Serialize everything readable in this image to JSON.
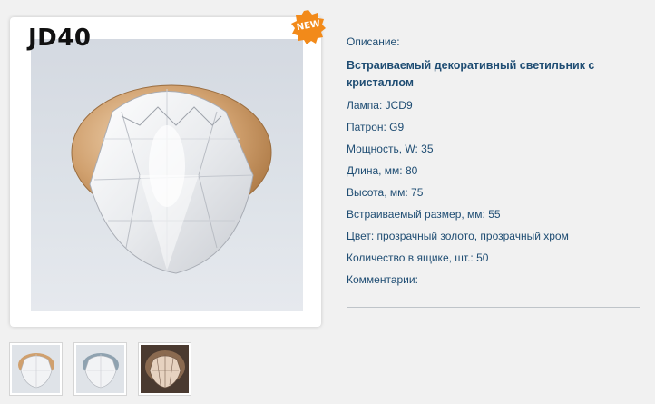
{
  "product": {
    "model": "JD40",
    "badge": "NEW"
  },
  "details": {
    "description_label": "Описание:",
    "title": "Встраиваемый декоративный светильник с кристаллом",
    "specs": [
      "Лампа: JCD9",
      "Патрон: G9",
      "Мощность, W: 35",
      "Длина, мм: 80",
      "Высота, мм: 75",
      "Встраиваемый размер, мм: 55",
      "Цвет: прозрачный золото, прозрачный хром",
      "Количество в ящике, шт.: 50",
      "Комментарии:"
    ]
  },
  "thumbnails": [
    {
      "name": "thumbnail-gold"
    },
    {
      "name": "thumbnail-chrome"
    },
    {
      "name": "thumbnail-lit"
    }
  ],
  "colors": {
    "page_bg": "#f1f1f1",
    "text": "#1f4d73",
    "badge": "#f28a1a",
    "gold": "#c99a66"
  }
}
